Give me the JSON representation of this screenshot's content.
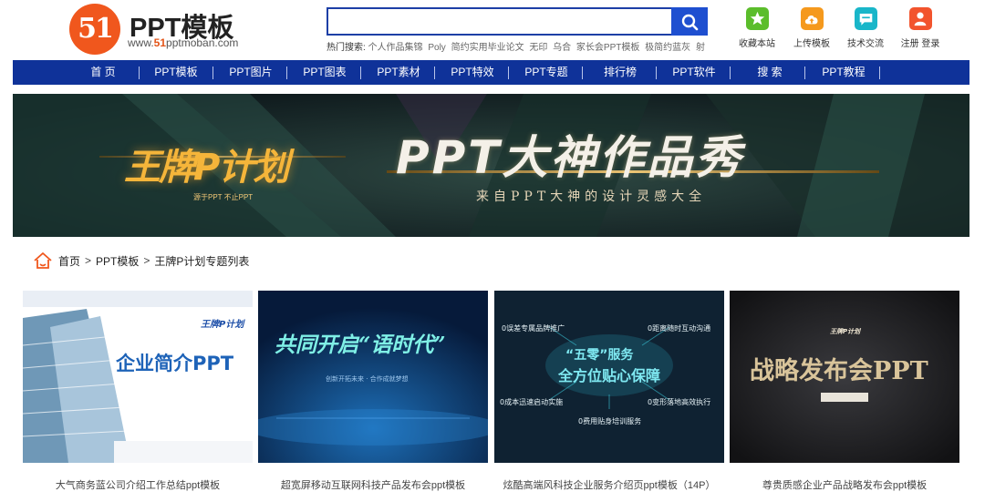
{
  "header": {
    "logo_mark": "51",
    "logo_name": "PPT模板",
    "logo_url_prefix": "www.",
    "logo_url_highlight": "51",
    "logo_url_suffix": "pptmoban.com",
    "search_placeholder": "",
    "hot_label": "热门搜索:",
    "hot_keywords": [
      "个人作品集锦",
      "Poly",
      "简约实用毕业论文",
      "无印",
      "乌合",
      "家长会PPT模板",
      "极简约蓝灰",
      "射"
    ],
    "quick_links": [
      {
        "label": "收藏本站",
        "icon": "star-icon",
        "color": "#5bbd2b"
      },
      {
        "label": "上传模板",
        "icon": "upload-cloud-icon",
        "color": "#f5991d"
      },
      {
        "label": "技术交流",
        "icon": "chat-icon",
        "color": "#19b6c9"
      },
      {
        "label": "注册 登录",
        "icon": "user-icon",
        "color": "#f2542d"
      }
    ]
  },
  "nav": {
    "items": [
      "首 页",
      "PPT模板",
      "PPT图片",
      "PPT图表",
      "PPT素材",
      "PPT特效",
      "PPT专题",
      "排行榜",
      "PPT软件",
      "搜 索",
      "PPT教程"
    ]
  },
  "banner": {
    "logo_text": "王牌P计划",
    "logo_sub": "源于PPT 不止PPT",
    "title": "PPT大神作品秀",
    "subtitle": "来自PPT大神的设计灵感大全"
  },
  "breadcrumb": {
    "items": [
      "首页",
      "PPT模板",
      "王牌P计划专题列表"
    ],
    "separator": ">"
  },
  "cards": [
    {
      "caption": "大气商务蓝公司介绍工作总结ppt模板",
      "thumb_title": "企业简介PPT",
      "thumb_brand": "王牌P计划"
    },
    {
      "caption": "超宽屏移动互联网科技产品发布会ppt模板",
      "thumb_title": "共同开启“语时代”",
      "thumb_sub": "创新开拓未来 · 合作成就梦想"
    },
    {
      "caption": "炫酷高端风科技企业服务介绍页ppt模板（14P）",
      "thumb_title_1": "“五零”服务",
      "thumb_title_2": "全方位贴心保障",
      "thumb_points": [
        "0误差专属品牌推广",
        "0距离随时互动沟通",
        "0成本迅速启动实施",
        "0变形落地高效执行",
        "0费用贴身培训服务"
      ]
    },
    {
      "caption": "尊贵质感企业产品战略发布会ppt模板",
      "thumb_title": "战略发布会PPT",
      "thumb_brand": "王牌P计划"
    }
  ],
  "colors": {
    "nav_bg": "#0f3299",
    "search_border": "#1d3fa6",
    "search_button": "#1e4fd0",
    "logo_orange": "#f0571d"
  }
}
